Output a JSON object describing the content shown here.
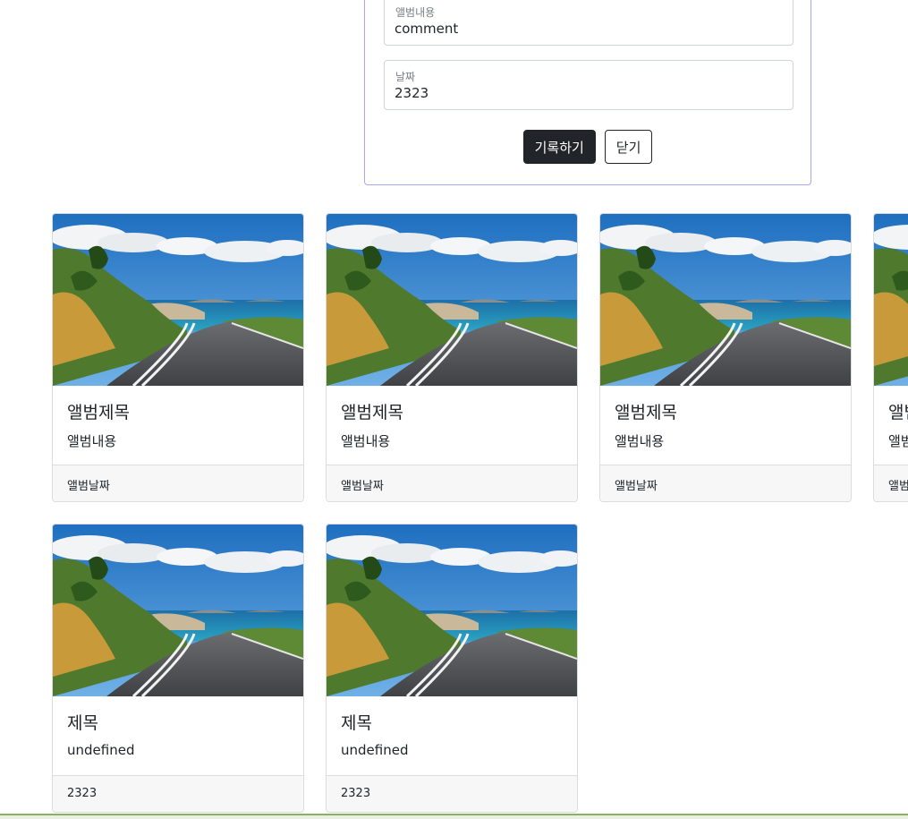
{
  "form": {
    "comment_label": "앨범내용",
    "comment_value": "comment",
    "date_label": "날짜",
    "date_value": "2323",
    "submit_label": "기록하기",
    "close_label": "닫기"
  },
  "cards": [
    {
      "title": "앨범제목",
      "text": "앨범내용",
      "footer": "앨범날짜"
    },
    {
      "title": "앨범제목",
      "text": "앨범내용",
      "footer": "앨범날짜"
    },
    {
      "title": "앨범제목",
      "text": "앨범내용",
      "footer": "앨범날짜"
    },
    {
      "title": "앨범제목",
      "text": "앨범내용",
      "footer": "앨범날짜"
    },
    {
      "title": "제목",
      "text": "undefined",
      "footer": "2323"
    },
    {
      "title": "제목",
      "text": "undefined",
      "footer": "2323"
    }
  ]
}
